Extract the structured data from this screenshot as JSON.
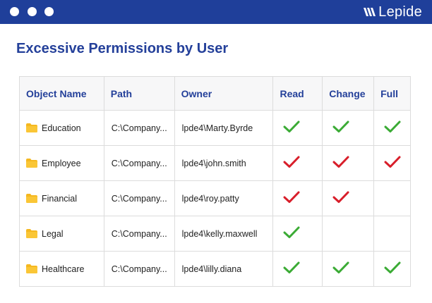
{
  "brand": {
    "name": "Lepide"
  },
  "title": "Excessive Permissions by User",
  "columns": {
    "object_name": "Object Name",
    "path": "Path",
    "owner": "Owner",
    "read": "Read",
    "change": "Change",
    "full": "Full"
  },
  "rows": [
    {
      "object": "Education",
      "path": "C:\\Company...",
      "owner": "lpde4\\Marty.Byrde",
      "read": "allowed",
      "change": "allowed",
      "full": "allowed"
    },
    {
      "object": "Employee",
      "path": "C:\\Company...",
      "owner": "lpde4\\john.smith",
      "read": "excessive",
      "change": "excessive",
      "full": "excessive"
    },
    {
      "object": "Financial",
      "path": "C:\\Company...",
      "owner": "lpde4\\roy.patty",
      "read": "excessive",
      "change": "excessive",
      "full": "none"
    },
    {
      "object": "Legal",
      "path": "C:\\Company...",
      "owner": "lpde4\\kelly.maxwell",
      "read": "allowed",
      "change": "none",
      "full": "none"
    },
    {
      "object": "Healthcare",
      "path": "C:\\Company...",
      "owner": "lpde4\\lilly.diana",
      "read": "allowed",
      "change": "allowed",
      "full": "allowed"
    }
  ],
  "icons": {
    "folder": "folder-icon",
    "check": "check-icon"
  },
  "colors": {
    "header_bar": "#1f3f9a",
    "title": "#24409a",
    "folder": "#f5b820",
    "check_allowed": "#3bab35",
    "check_excessive": "#d81e2a"
  }
}
